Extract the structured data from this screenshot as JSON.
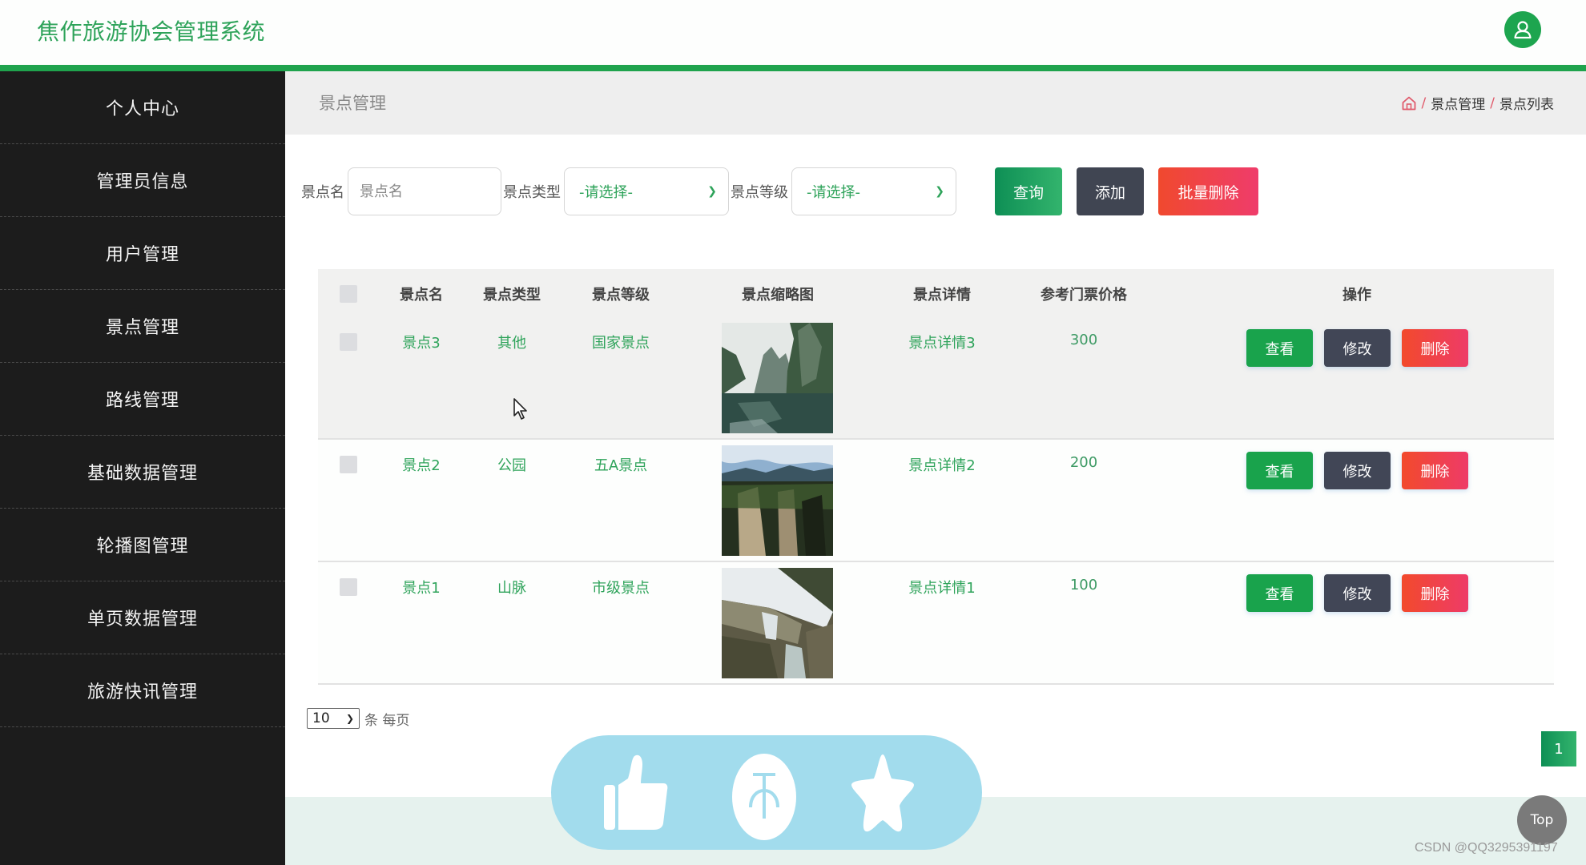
{
  "header": {
    "app_title": "焦作旅游协会管理系统",
    "avatar_icon": "user-icon",
    "accent_color": "#1fa34d"
  },
  "sidebar": {
    "items": [
      {
        "label": "个人中心"
      },
      {
        "label": "管理员信息"
      },
      {
        "label": "用户管理"
      },
      {
        "label": "景点管理"
      },
      {
        "label": "路线管理"
      },
      {
        "label": "基础数据管理"
      },
      {
        "label": "轮播图管理"
      },
      {
        "label": "单页数据管理"
      },
      {
        "label": "旅游快讯管理"
      }
    ]
  },
  "title_bar": {
    "page_title": "景点管理",
    "breadcrumb": {
      "home_icon": "home-icon",
      "separator": "/",
      "items": [
        "景点管理",
        "景点列表"
      ]
    }
  },
  "search": {
    "name_label": "景点名",
    "name_placeholder": "景点名",
    "type_label": "景点类型",
    "type_selected": "-请选择-",
    "level_label": "景点等级",
    "level_selected": "-请选择-",
    "query_button": "查询",
    "add_button": "添加",
    "batch_delete_button": "批量删除"
  },
  "table": {
    "columns": [
      "景点名",
      "景点类型",
      "景点等级",
      "景点缩略图",
      "景点详情",
      "参考门票价格",
      "操作"
    ],
    "rows": [
      {
        "name": "景点3",
        "type": "其他",
        "level": "国家景点",
        "thumbnail": "lake-karst-peaks-photo",
        "detail": "景点详情3",
        "price": "300"
      },
      {
        "name": "景点2",
        "type": "公园",
        "level": "五A景点",
        "thumbnail": "cliff-mountains-photo",
        "detail": "景点详情2",
        "price": "200"
      },
      {
        "name": "景点1",
        "type": "山脉",
        "level": "市级景点",
        "thumbnail": "waterfall-photo",
        "detail": "景点详情1",
        "price": "100"
      }
    ],
    "actions": {
      "view": "查看",
      "edit": "修改",
      "delete": "删除"
    }
  },
  "pagination": {
    "page_size": "10",
    "page_size_suffix": "条 每页",
    "current_page": "1"
  },
  "overlay": {
    "float_bar_icons": [
      "thumbs-up-icon",
      "coin-icon",
      "star-icon"
    ],
    "top_button": "Top",
    "watermark": "CSDN @QQ3295391197"
  }
}
